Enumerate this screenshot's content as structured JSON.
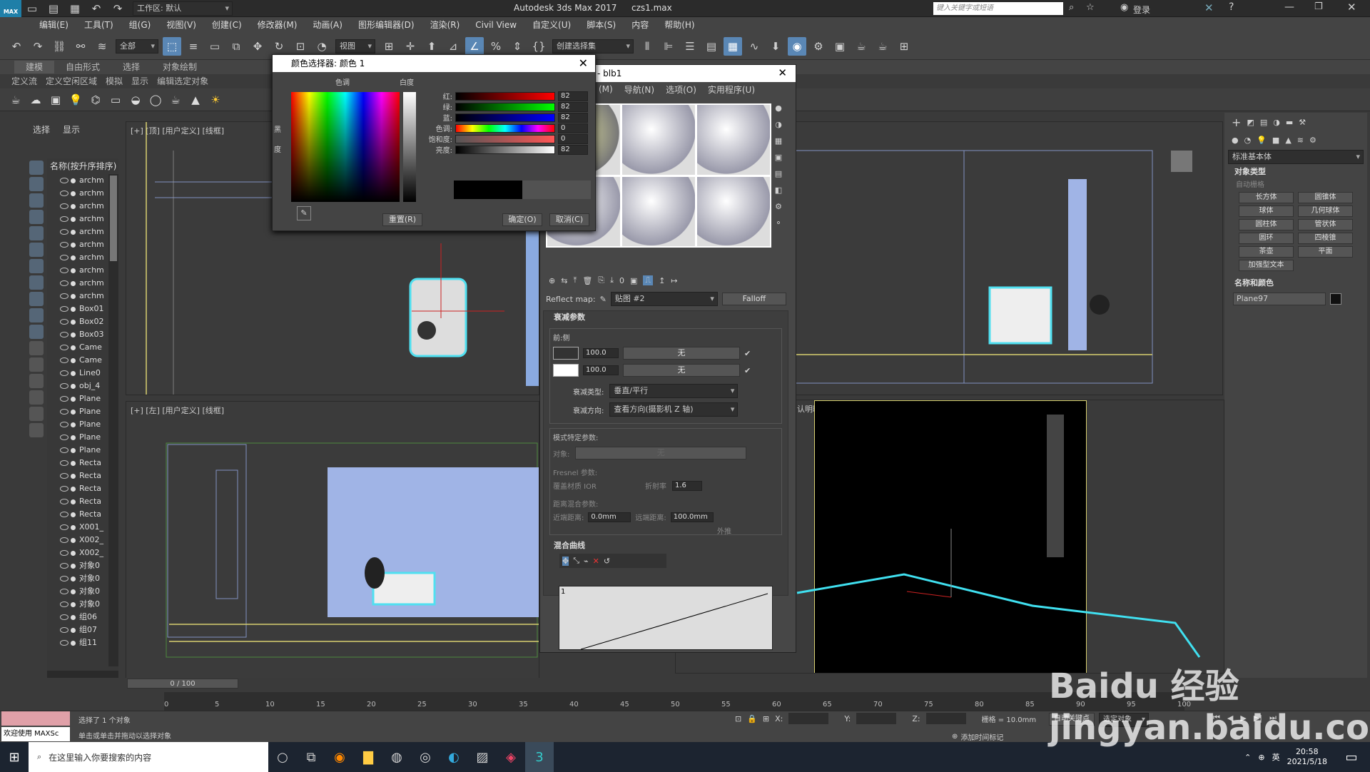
{
  "titlebar": {
    "workspace": "工作区: 默认",
    "app_title": "Autodesk 3ds Max 2017",
    "filename": "czs1.max",
    "search_placeholder": "键入关键字或短语",
    "login": "登录",
    "logo": "MAX"
  },
  "menu": [
    "编辑(E)",
    "工具(T)",
    "组(G)",
    "视图(V)",
    "创建(C)",
    "修改器(M)",
    "动画(A)",
    "图形编辑器(D)",
    "渲染(R)",
    "Civil View",
    "自定义(U)",
    "脚本(S)",
    "内容",
    "帮助(H)"
  ],
  "toolbar": {
    "filter": "全部",
    "view": "视图",
    "selset": "创建选择集"
  },
  "ribbon": {
    "tabs": [
      "建模",
      "自由形式",
      "选择",
      "对象绘制"
    ],
    "subtabs": [
      "定义流",
      "定义空闲区域",
      "模拟",
      "显示",
      "编辑选定对象"
    ]
  },
  "scene": {
    "tab_select": "选择",
    "tab_display": "显示",
    "header": "名称(按升序排序)",
    "items": [
      "archm",
      "archm",
      "archm",
      "archm",
      "archm",
      "archm",
      "archm",
      "archm",
      "archm",
      "archm",
      "Box01",
      "Box02",
      "Box03",
      "Came",
      "Came",
      "Line0",
      "obj_4",
      "Plane",
      "Plane",
      "Plane",
      "Plane",
      "Plane",
      "Recta",
      "Recta",
      "Recta",
      "Recta",
      "Recta",
      "X001_",
      "X002_",
      "X002_",
      "对象0",
      "对象0",
      "对象0",
      "对象0",
      "组06",
      "组07",
      "组11"
    ]
  },
  "viewports": {
    "top": "[+] [顶] [用户定义] [线框]",
    "left": "[+] [左] [用户定义] [线框]",
    "persp": "认明暗处理 ]"
  },
  "colordlg": {
    "title": "颜色选择器: 颜色 1",
    "hue": "色调",
    "white": "白度",
    "black": "黑",
    "degree": "度",
    "channels": [
      {
        "label": "红:",
        "value": "82"
      },
      {
        "label": "绿:",
        "value": "82"
      },
      {
        "label": "蓝:",
        "value": "82"
      },
      {
        "label": "色调:",
        "value": "0"
      },
      {
        "label": "饱和度:",
        "value": "0"
      },
      {
        "label": "亮度:",
        "value": "82"
      }
    ],
    "reset": "重置(R)",
    "ok": "确定(O)",
    "cancel": "取消(C)"
  },
  "matdlg": {
    "title": "- blb1",
    "menu": [
      "(M)",
      "导航(N)",
      "选项(O)",
      "实用程序(U)"
    ],
    "reflect_label": "Reflect map:",
    "map_name": "贴图 #2",
    "map_type": "Falloff",
    "falloff_title": "衰减参数",
    "front_side": "前:侧",
    "v1": "100.0",
    "v2": "100.0",
    "none": "无",
    "falloff_type_label": "衰减类型:",
    "falloff_type": "垂直/平行",
    "falloff_dir_label": "衰减方向:",
    "falloff_dir": "查看方向(摄影机 Z 轴)",
    "mode_title": "模式特定参数:",
    "object_label": "对象:",
    "object_value": "无",
    "fresnel_title": "Fresnel 参数:",
    "override_ior": "覆盖材质 IOR",
    "ior_label": "折射率",
    "ior": "1.6",
    "dist_title": "距离混合参数:",
    "near_label": "近端距离:",
    "near": "0.0mm",
    "far_label": "远端距离:",
    "far": "100.0mm",
    "extrap": "外推",
    "curve_title": "混合曲线",
    "curve_tick": "1"
  },
  "cmd": {
    "dropdown": "标准基本体",
    "obj_type": "对象类型",
    "autogrid": "自动栅格",
    "buttons": [
      "长方体",
      "圆锥体",
      "球体",
      "几何球体",
      "圆柱体",
      "管状体",
      "圆环",
      "四棱锥",
      "茶壶",
      "平面",
      "加强型文本"
    ],
    "name_color": "名称和颜色",
    "object_name": "Plane97"
  },
  "timeline": {
    "frame": "0 / 100",
    "ticks": [
      "0",
      "5",
      "10",
      "15",
      "20",
      "25",
      "30",
      "35",
      "40",
      "45",
      "50",
      "55",
      "60",
      "65",
      "70",
      "75",
      "80",
      "85",
      "90",
      "95",
      "100"
    ]
  },
  "status": {
    "welcome": "欢迎使用 MAXSc",
    "line1": "选择了 1 个对象",
    "line2": "单击或单击并拖动以选择对象",
    "x": "X:",
    "y": "Y:",
    "z": "Z:",
    "grid": "栅格 = 10.0mm",
    "addtag": "添加时间标记",
    "autokey": "自动关键点",
    "selobj": "选定对象"
  },
  "taskbar": {
    "search": "在这里输入你要搜索的内容",
    "time": "20:58",
    "date": "2021/5/18",
    "ime": "英"
  },
  "watermark": "Baidu 经验 jingyan.baidu.com"
}
